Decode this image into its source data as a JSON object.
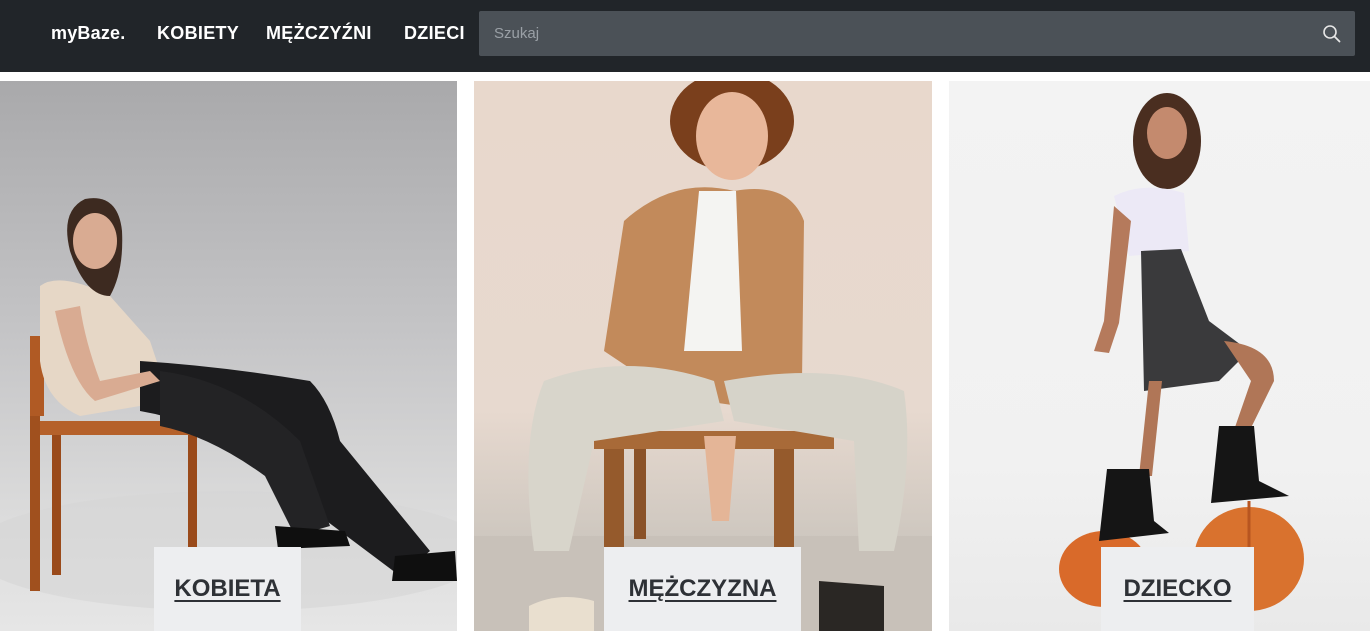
{
  "header": {
    "brand": "myBaze.",
    "nav": [
      {
        "label": "KOBIETY"
      },
      {
        "label": "MĘŻCZYŹNI"
      },
      {
        "label": "DZIECI"
      }
    ],
    "search": {
      "placeholder": "Szukaj",
      "value": "",
      "icon": "search-icon"
    }
  },
  "tiles": [
    {
      "label": "KOBIETA",
      "image": "woman-seated-on-chair-photo"
    },
    {
      "label": "MĘŻCZYZNA",
      "image": "man-in-camel-blazer-photo"
    },
    {
      "label": "DZIECKO",
      "image": "girl-on-pumpkins-photo"
    }
  ],
  "colors": {
    "navbar_bg": "#212529",
    "search_bg": "#4b5157",
    "label_bg": "#edeef0",
    "label_text": "#2e3136"
  }
}
